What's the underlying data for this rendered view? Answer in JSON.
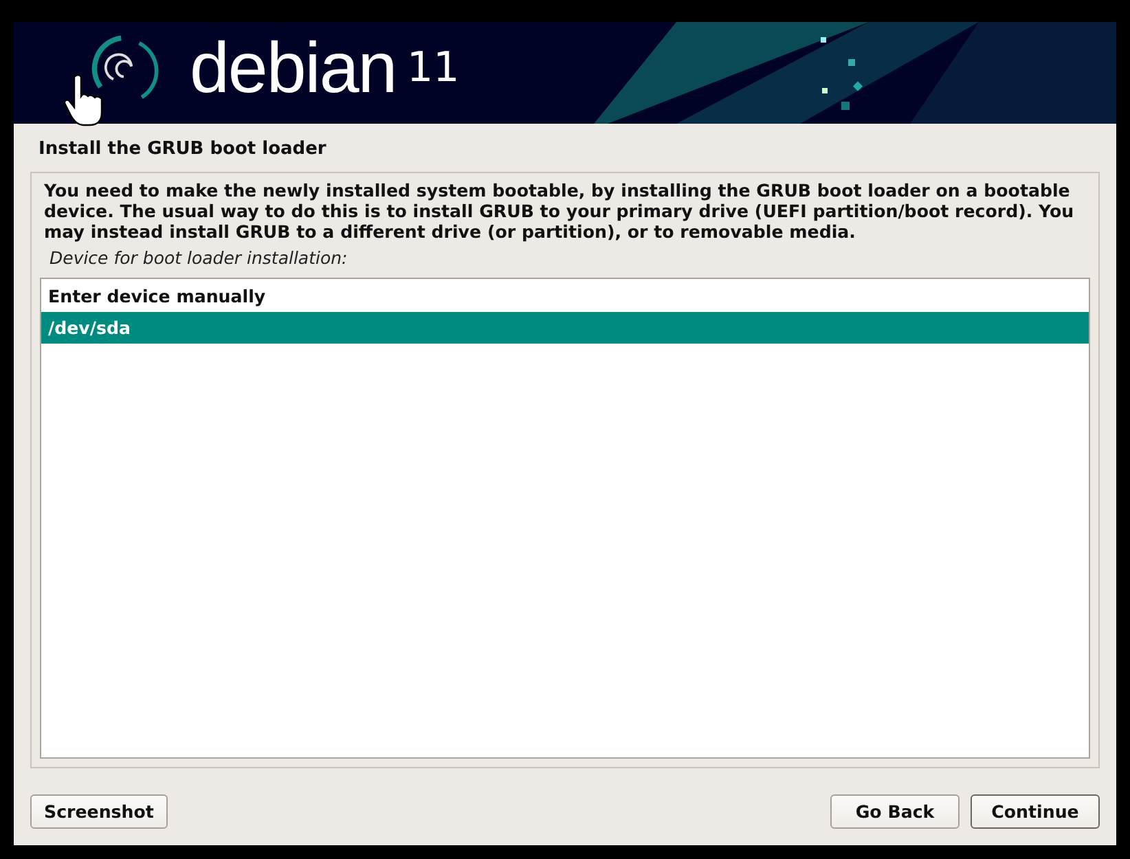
{
  "header": {
    "logo": "debian",
    "version": "11"
  },
  "title": "Install the GRUB boot loader",
  "description": "You need to make the newly installed system bootable, by installing the GRUB boot loader on a bootable device. The usual way to do this is to install GRUB to your primary drive (UEFI partition/boot record). You may instead install GRUB to a different drive (or partition), or to removable media.",
  "prompt": "Device for boot loader installation:",
  "options": [
    {
      "label": "Enter device manually",
      "selected": false
    },
    {
      "label": "/dev/sda",
      "selected": true
    }
  ],
  "buttons": {
    "left": [
      "Screenshot"
    ],
    "right": [
      "Go Back",
      "Continue"
    ]
  }
}
